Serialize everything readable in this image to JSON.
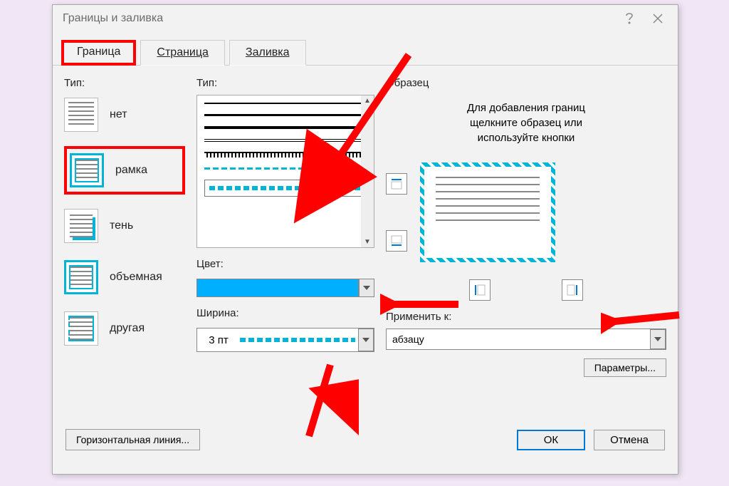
{
  "title": "Границы и заливка",
  "tabs": {
    "border": "Граница",
    "page": "Страница",
    "shading": "Заливка"
  },
  "col1": {
    "label": "Тип:",
    "items": [
      "нет",
      "рамка",
      "тень",
      "объемная",
      "другая"
    ]
  },
  "col2": {
    "style_label": "Тип:",
    "color_label": "Цвет:",
    "width_label": "Ширина:",
    "width_value": "3 пт"
  },
  "col3": {
    "label": "Образец",
    "hint1": "Для добавления границ",
    "hint2": "щелкните образец или",
    "hint3": "используйте кнопки",
    "apply_label": "Применить к:",
    "apply_value": "абзацу",
    "options_btn": "Параметры..."
  },
  "footer": {
    "hline": "Горизонтальная линия...",
    "ok": "ОК",
    "cancel": "Отмена"
  }
}
